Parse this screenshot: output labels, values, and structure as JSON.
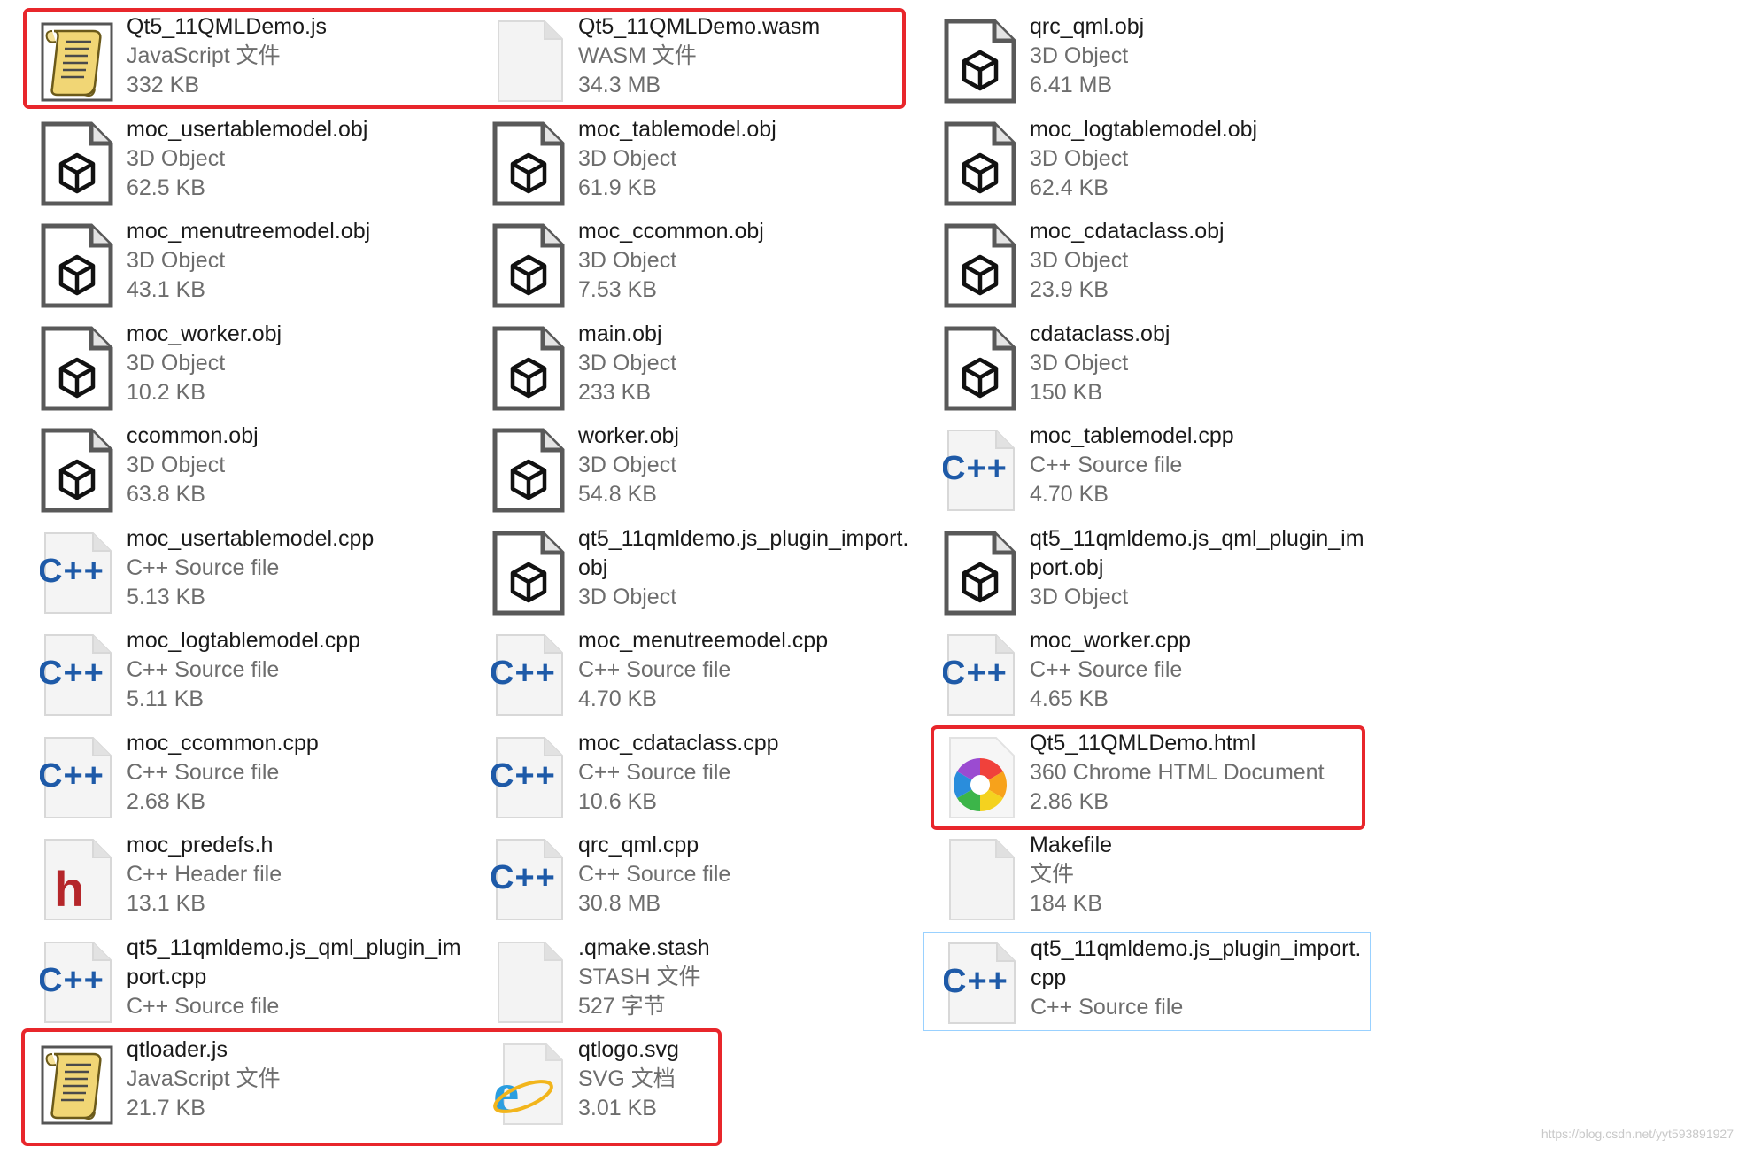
{
  "files": [
    {
      "name": "Qt5_11QMLDemo.js",
      "type": "JavaScript 文件",
      "size": "332 KB",
      "icon": "js-script-icon"
    },
    {
      "name": "Qt5_11QMLDemo.wasm",
      "type": "WASM 文件",
      "size": "34.3 MB",
      "icon": "blank-file-icon"
    },
    {
      "name": "qrc_qml.obj",
      "type": "3D Object",
      "size": "6.41 MB",
      "icon": "3d-object-icon"
    },
    {
      "name": "moc_usertablemodel.obj",
      "type": "3D Object",
      "size": "62.5 KB",
      "icon": "3d-object-icon"
    },
    {
      "name": "moc_tablemodel.obj",
      "type": "3D Object",
      "size": "61.9 KB",
      "icon": "3d-object-icon"
    },
    {
      "name": "moc_logtablemodel.obj",
      "type": "3D Object",
      "size": "62.4 KB",
      "icon": "3d-object-icon"
    },
    {
      "name": "moc_menutreemodel.obj",
      "type": "3D Object",
      "size": "43.1 KB",
      "icon": "3d-object-icon"
    },
    {
      "name": "moc_ccommon.obj",
      "type": "3D Object",
      "size": "7.53 KB",
      "icon": "3d-object-icon"
    },
    {
      "name": "moc_cdataclass.obj",
      "type": "3D Object",
      "size": "23.9 KB",
      "icon": "3d-object-icon"
    },
    {
      "name": "moc_worker.obj",
      "type": "3D Object",
      "size": "10.2 KB",
      "icon": "3d-object-icon"
    },
    {
      "name": "main.obj",
      "type": "3D Object",
      "size": "233 KB",
      "icon": "3d-object-icon"
    },
    {
      "name": "cdataclass.obj",
      "type": "3D Object",
      "size": "150 KB",
      "icon": "3d-object-icon"
    },
    {
      "name": "ccommon.obj",
      "type": "3D Object",
      "size": "63.8 KB",
      "icon": "3d-object-icon"
    },
    {
      "name": "worker.obj",
      "type": "3D Object",
      "size": "54.8 KB",
      "icon": "3d-object-icon"
    },
    {
      "name": "moc_tablemodel.cpp",
      "type": "C++ Source file",
      "size": "4.70 KB",
      "icon": "cpp-file-icon"
    },
    {
      "name": "moc_usertablemodel.cpp",
      "type": "C++ Source file",
      "size": "5.13 KB",
      "icon": "cpp-file-icon"
    },
    {
      "name": "qt5_11qmldemo.js_plugin_import.obj",
      "type": "3D Object",
      "size": "",
      "icon": "3d-object-icon"
    },
    {
      "name": "qt5_11qmldemo.js_qml_plugin_import.obj",
      "type": "3D Object",
      "size": "",
      "icon": "3d-object-icon"
    },
    {
      "name": "moc_logtablemodel.cpp",
      "type": "C++ Source file",
      "size": "5.11 KB",
      "icon": "cpp-file-icon"
    },
    {
      "name": "moc_menutreemodel.cpp",
      "type": "C++ Source file",
      "size": "4.70 KB",
      "icon": "cpp-file-icon"
    },
    {
      "name": "moc_worker.cpp",
      "type": "C++ Source file",
      "size": "4.65 KB",
      "icon": "cpp-file-icon"
    },
    {
      "name": "moc_ccommon.cpp",
      "type": "C++ Source file",
      "size": "2.68 KB",
      "icon": "cpp-file-icon"
    },
    {
      "name": "moc_cdataclass.cpp",
      "type": "C++ Source file",
      "size": "10.6 KB",
      "icon": "cpp-file-icon"
    },
    {
      "name": "Qt5_11QMLDemo.html",
      "type": "360 Chrome HTML Document",
      "size": "2.86 KB",
      "icon": "browser-360-icon"
    },
    {
      "name": "moc_predefs.h",
      "type": "C++ Header file",
      "size": "13.1 KB",
      "icon": "header-file-icon"
    },
    {
      "name": "qrc_qml.cpp",
      "type": "C++ Source file",
      "size": "30.8 MB",
      "icon": "cpp-file-icon"
    },
    {
      "name": "Makefile",
      "type": "文件",
      "size": "184 KB",
      "icon": "blank-file-icon"
    },
    {
      "name": "qt5_11qmldemo.js_qml_plugin_import.cpp",
      "type": "C++ Source file",
      "size": "",
      "icon": "cpp-file-icon"
    },
    {
      "name": ".qmake.stash",
      "type": "STASH 文件",
      "size": "527 字节",
      "icon": "blank-file-icon"
    },
    {
      "name": "qt5_11qmldemo.js_plugin_import.cpp",
      "type": "C++ Source file",
      "size": "",
      "icon": "cpp-file-icon",
      "selected": true
    },
    {
      "name": "qtloader.js",
      "type": "JavaScript 文件",
      "size": "21.7 KB",
      "icon": "js-script-icon"
    },
    {
      "name": "qtlogo.svg",
      "type": "SVG 文档",
      "size": "3.01 KB",
      "icon": "ie-svg-icon"
    }
  ],
  "watermark": "https://blog.csdn.net/yyt593891927",
  "highlight_color": "#e8262b",
  "selection_color": "#99d1ff"
}
